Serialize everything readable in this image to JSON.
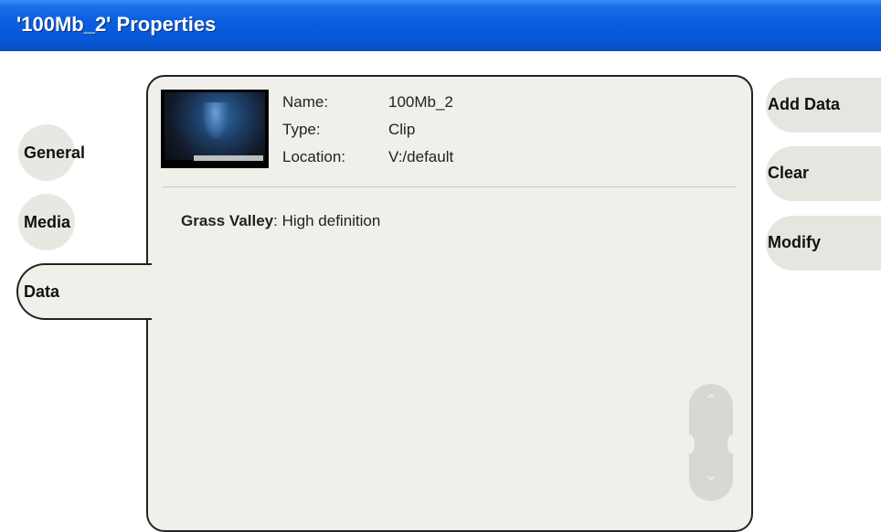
{
  "window": {
    "title": "'100Mb_2' Properties"
  },
  "tabs": [
    {
      "label": "General"
    },
    {
      "label": "Media"
    },
    {
      "label": "Data"
    }
  ],
  "selected_tab": "Data",
  "clip": {
    "name_label": "Name:",
    "name_value": "100Mb_2",
    "type_label": "Type:",
    "type_value": "Clip",
    "location_label": "Location:",
    "location_value": "V:/default"
  },
  "association": {
    "key": "Grass Valley",
    "sep": ": ",
    "value": "High definition"
  },
  "actions": {
    "add": "Add Data",
    "clear": "Clear",
    "modify": "Modify"
  },
  "scroll": {
    "up_icon": "chevron-up-icon",
    "down_icon": "chevron-down-icon"
  },
  "colors": {
    "titlebar": "#0a5fe0",
    "panel": "#f0efea",
    "button": "#e6e5e0"
  }
}
